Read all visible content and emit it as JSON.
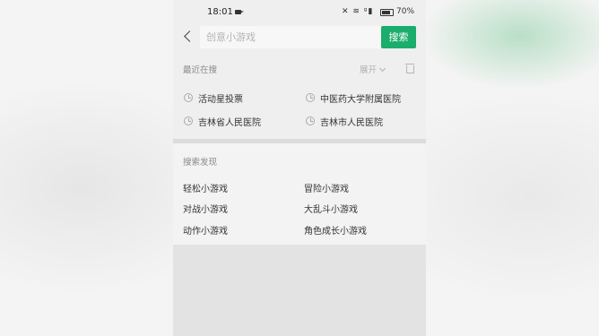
{
  "status_bar": {
    "time": "18:01",
    "icons_text": "✕ ≋ ᵍ▮",
    "battery": "70%"
  },
  "search": {
    "placeholder": "创意小游戏",
    "button_label": "搜索"
  },
  "recent": {
    "title": "最近在搜",
    "expand_label": "展开",
    "items": [
      {
        "label": "活动星投票"
      },
      {
        "label": "中医药大学附属医院"
      },
      {
        "label": "吉林省人民医院"
      },
      {
        "label": "吉林市人民医院"
      }
    ]
  },
  "discover": {
    "title": "搜索发现",
    "items": [
      {
        "label": "轻松小游戏"
      },
      {
        "label": "冒险小游戏"
      },
      {
        "label": "对战小游戏"
      },
      {
        "label": "大乱斗小游戏"
      },
      {
        "label": "动作小游戏"
      },
      {
        "label": "角色成长小游戏"
      }
    ]
  },
  "colors": {
    "accent": "#1aad6b"
  }
}
